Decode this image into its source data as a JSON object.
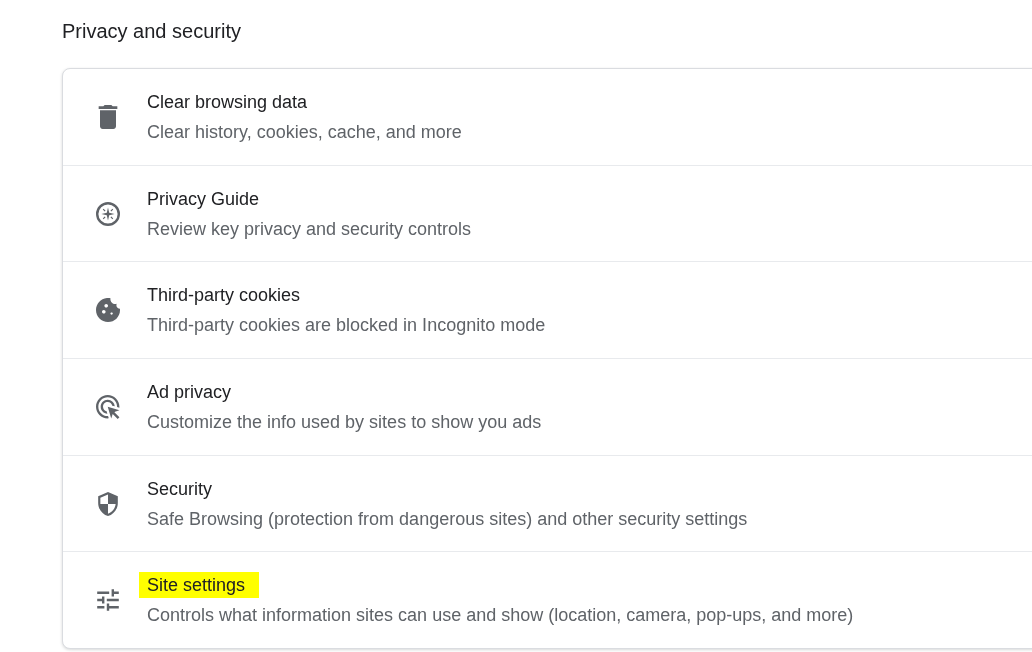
{
  "section": {
    "title": "Privacy and security"
  },
  "items": [
    {
      "title": "Clear browsing data",
      "description": "Clear history, cookies, cache, and more",
      "highlighted": false
    },
    {
      "title": "Privacy Guide",
      "description": "Review key privacy and security controls",
      "highlighted": false
    },
    {
      "title": "Third-party cookies",
      "description": "Third-party cookies are blocked in Incognito mode",
      "highlighted": false
    },
    {
      "title": "Ad privacy",
      "description": "Customize the info used by sites to show you ads",
      "highlighted": false
    },
    {
      "title": "Security",
      "description": "Safe Browsing (protection from dangerous sites) and other security settings",
      "highlighted": false
    },
    {
      "title": "Site settings",
      "description": "Controls what information sites can use and show (location, camera, pop-ups, and more)",
      "highlighted": true
    }
  ]
}
